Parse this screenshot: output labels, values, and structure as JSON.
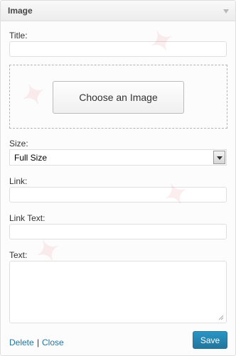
{
  "widget": {
    "title": "Image"
  },
  "form": {
    "title_label": "Title:",
    "title_value": "",
    "choose_button": "Choose an Image",
    "size_label": "Size:",
    "size_value": "Full Size",
    "link_label": "Link:",
    "link_value": "",
    "link_text_label": "Link Text:",
    "link_text_value": "",
    "text_label": "Text:",
    "text_value": ""
  },
  "footer": {
    "delete_label": "Delete",
    "separator": "|",
    "close_label": "Close",
    "save_label": "Save"
  },
  "colors": {
    "link": "#21759b",
    "save_button": "#21759b"
  }
}
